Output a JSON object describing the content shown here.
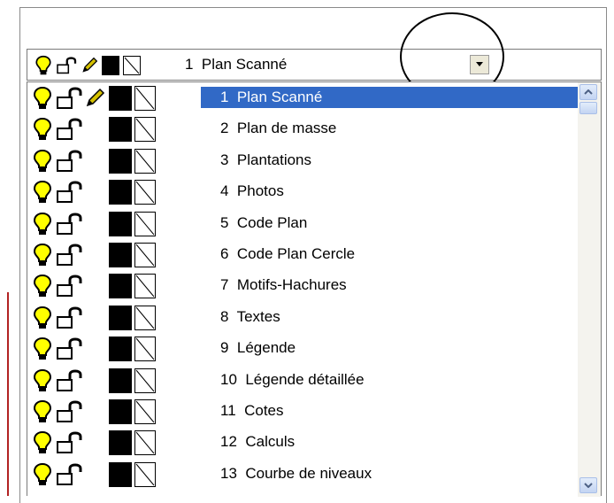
{
  "combo": {
    "selected_label": "1  Plan Scanné"
  },
  "layers": [
    {
      "label": "1  Plan Scanné",
      "selected": true,
      "editing": true
    },
    {
      "label": "2  Plan de masse",
      "selected": false,
      "editing": false
    },
    {
      "label": "3  Plantations",
      "selected": false,
      "editing": false
    },
    {
      "label": "4  Photos",
      "selected": false,
      "editing": false
    },
    {
      "label": "5  Code Plan",
      "selected": false,
      "editing": false
    },
    {
      "label": "6  Code Plan Cercle",
      "selected": false,
      "editing": false
    },
    {
      "label": "7  Motifs-Hachures",
      "selected": false,
      "editing": false
    },
    {
      "label": "8  Textes",
      "selected": false,
      "editing": false
    },
    {
      "label": "9  Légende",
      "selected": false,
      "editing": false
    },
    {
      "label": "10  Légende détaillée",
      "selected": false,
      "editing": false
    },
    {
      "label": "11  Cotes",
      "selected": false,
      "editing": false
    },
    {
      "label": "12  Calculs",
      "selected": false,
      "editing": false
    },
    {
      "label": "13  Courbe de niveaux",
      "selected": false,
      "editing": false
    }
  ],
  "icons": {
    "visibility": "light-bulb-icon",
    "lock": "padlock-open-icon",
    "current": "pencil-icon",
    "color": "color-swatch-icon",
    "linetype": "linetype-icon",
    "dropdown": "chevron-down-icon",
    "scroll_up": "chevron-up-icon",
    "scroll_down": "chevron-down-icon"
  },
  "colors": {
    "selection": "#3169c6",
    "bulb": "#ffff00",
    "swatch": "#000000",
    "annotation": "#000000"
  }
}
